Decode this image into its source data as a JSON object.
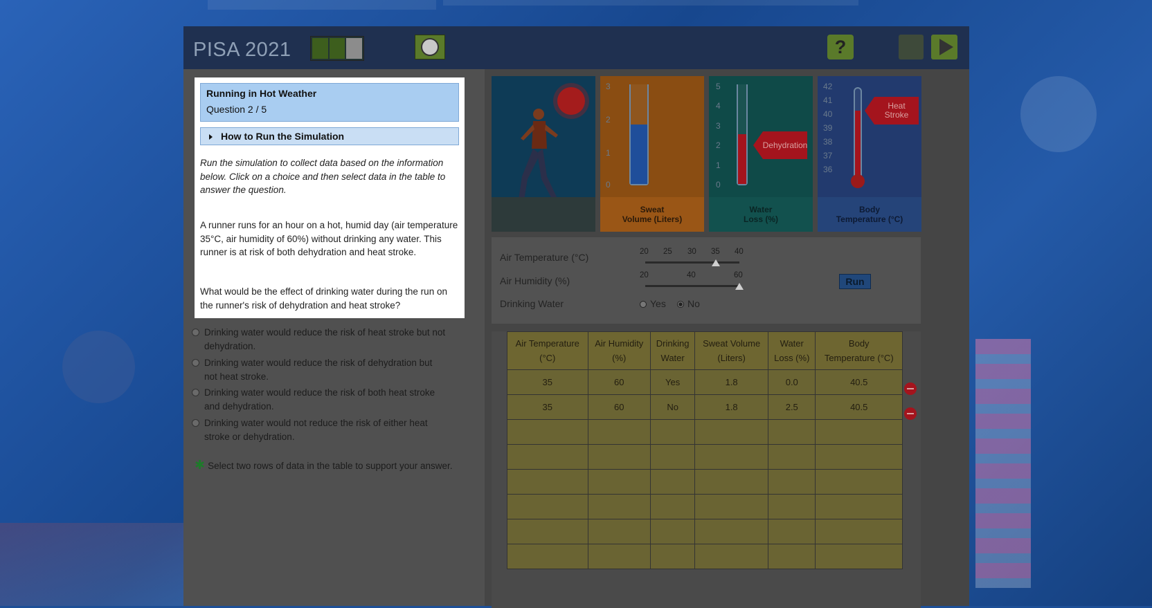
{
  "header": {
    "brand": "PISA 2021"
  },
  "question": {
    "title": "Running in Hot Weather",
    "number": "Question 2 / 5",
    "howto_label": "How to Run the Simulation",
    "instructions": "Run the simulation to collect data based on the information below. Click on a choice and then select data in the table to answer the question.",
    "stem_part1": "A runner runs for an hour on a hot, humid day (air temperature 35°C, air humidity of 60%) without drinking any water. This runner is at risk of both dehydration and heat stroke.",
    "stem_part2": "What would be the effect of drinking water during the run on the runner's risk of dehydration and heat stroke?",
    "options": [
      "Drinking water would reduce the risk of heat stroke but not dehydration.",
      "Drinking water would reduce the risk of dehydration but not heat stroke.",
      "Drinking water would reduce the risk of both heat stroke and dehydration.",
      "Drinking water would not reduce the risk of either heat stroke or dehydration."
    ],
    "note": "Select two rows of data in the table to support your answer."
  },
  "gauges": {
    "sweat": {
      "label_line1": "Sweat",
      "label_line2": "Volume (Liters)",
      "ticks": [
        "3",
        "2",
        "1",
        "0"
      ],
      "level": 1.8,
      "max": 3,
      "color": "#1f4e9a"
    },
    "water": {
      "label_line1": "Water",
      "label_line2": "Loss (%)",
      "ticks": [
        "5",
        "4",
        "3",
        "2",
        "1",
        "0"
      ],
      "level": 2.5,
      "max": 5,
      "color": "#a4141d",
      "flag": "Dehydration"
    },
    "body": {
      "label_line1": "Body",
      "label_line2": "Temperature (°C)",
      "ticks": [
        "42",
        "41",
        "40",
        "39",
        "38",
        "37",
        "36"
      ],
      "level": 40.5,
      "min": 36,
      "max": 42,
      "color": "#a4141d",
      "flag_line1": "Heat",
      "flag_line2": "Stroke"
    }
  },
  "controls": {
    "air_temp_label": "Air Temperature (°C)",
    "air_temp_scale": [
      "20",
      "25",
      "30",
      "35",
      "40"
    ],
    "air_temp_value": 35,
    "humidity_label": "Air Humidity (%)",
    "humidity_scale": [
      "20",
      "40",
      "60"
    ],
    "humidity_value": 60,
    "drinking_label": "Drinking Water",
    "yes_label": "Yes",
    "no_label": "No",
    "drinking_selected": "No",
    "run_label": "Run"
  },
  "table": {
    "headers": [
      [
        "Air Temperature",
        "(°C)"
      ],
      [
        "Air Humidity",
        "(%)"
      ],
      [
        "Drinking",
        "Water"
      ],
      [
        "Sweat Volume",
        "(Liters)"
      ],
      [
        "Water",
        "Loss (%)"
      ],
      [
        "Body",
        "Temperature (°C)"
      ]
    ],
    "rows": [
      [
        "35",
        "60",
        "Yes",
        "1.8",
        "0.0",
        "40.5"
      ],
      [
        "35",
        "60",
        "No",
        "1.8",
        "2.5",
        "40.5"
      ]
    ],
    "empty_rows": 6
  }
}
